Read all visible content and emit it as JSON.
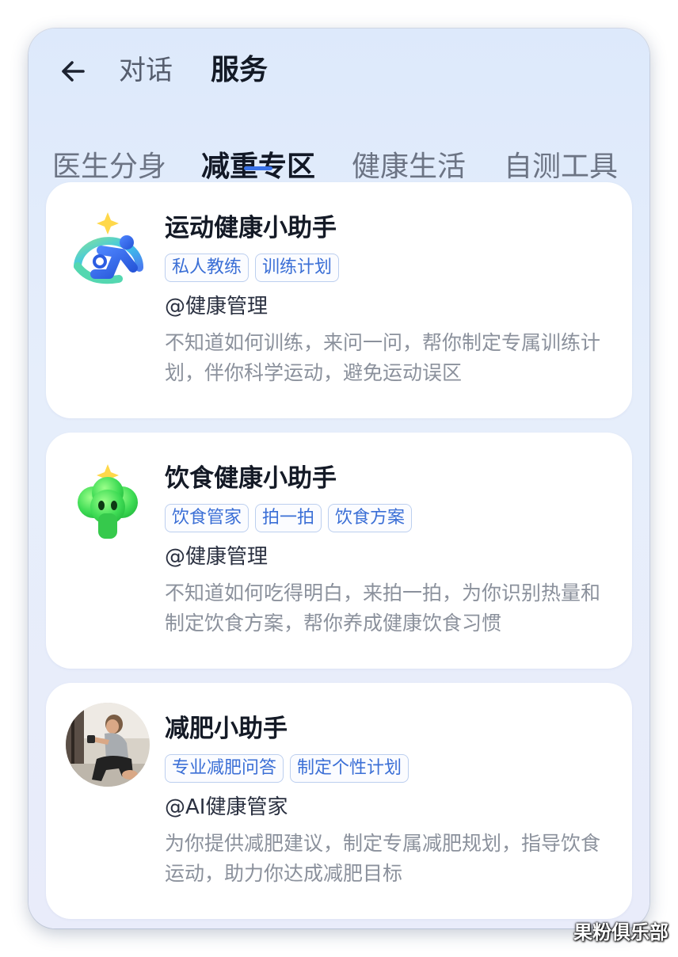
{
  "header": {
    "tabs": [
      {
        "label": "对话",
        "active": false
      },
      {
        "label": "服务",
        "active": true
      }
    ]
  },
  "categories": [
    {
      "label": "医生分身",
      "active": false
    },
    {
      "label": "减重专区",
      "active": true
    },
    {
      "label": "健康生活",
      "active": false
    },
    {
      "label": "自测工具",
      "active": false
    }
  ],
  "assistants": [
    {
      "title": "运动健康小助手",
      "tags": [
        "私人教练",
        "训练计划"
      ],
      "author": "@健康管理",
      "description": "不知道如何训练，来问一问，帮你制定专属训练计划，伴你科学运动，避免运动误区",
      "icon": "sport-runner-icon"
    },
    {
      "title": "饮食健康小助手",
      "tags": [
        "饮食管家",
        "拍一拍",
        "饮食方案"
      ],
      "author": "@健康管理",
      "description": "不知道如何吃得明白，来拍一拍，为你识别热量和制定饮食方案，帮你养成健康饮食习惯",
      "icon": "broccoli-mascot-icon"
    },
    {
      "title": "减肥小助手",
      "tags": [
        "专业减肥问答",
        "制定个性计划"
      ],
      "author": "@AI健康管家",
      "description": "为你提供减肥建议，制定专属减肥规划，指导饮食运动，助力你达成减肥目标",
      "icon": "fitness-photo-avatar"
    }
  ],
  "watermark": "果粉俱乐部",
  "colors": {
    "accent": "#3b73e8",
    "tag_text": "#3b6fd6",
    "tag_border": "#bccfef",
    "background": "#e3ecfb"
  }
}
